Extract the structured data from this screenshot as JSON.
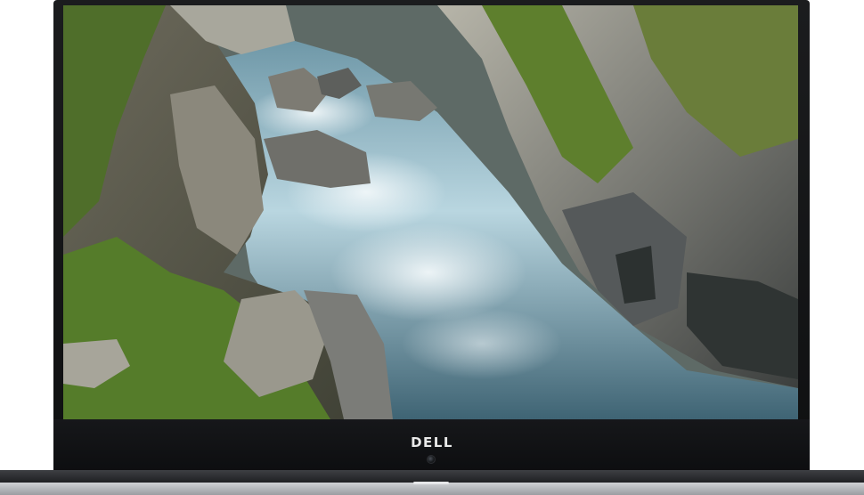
{
  "device": {
    "type": "laptop",
    "brand_logo": "DELL",
    "colors": {
      "bezel": "#121315",
      "base": "#b8babd"
    }
  },
  "wallpaper": {
    "subject": "river-canyon",
    "colors": {
      "water": "#8fb7c9",
      "rock": "#8d9092",
      "moss": "#5b7a2c"
    }
  }
}
